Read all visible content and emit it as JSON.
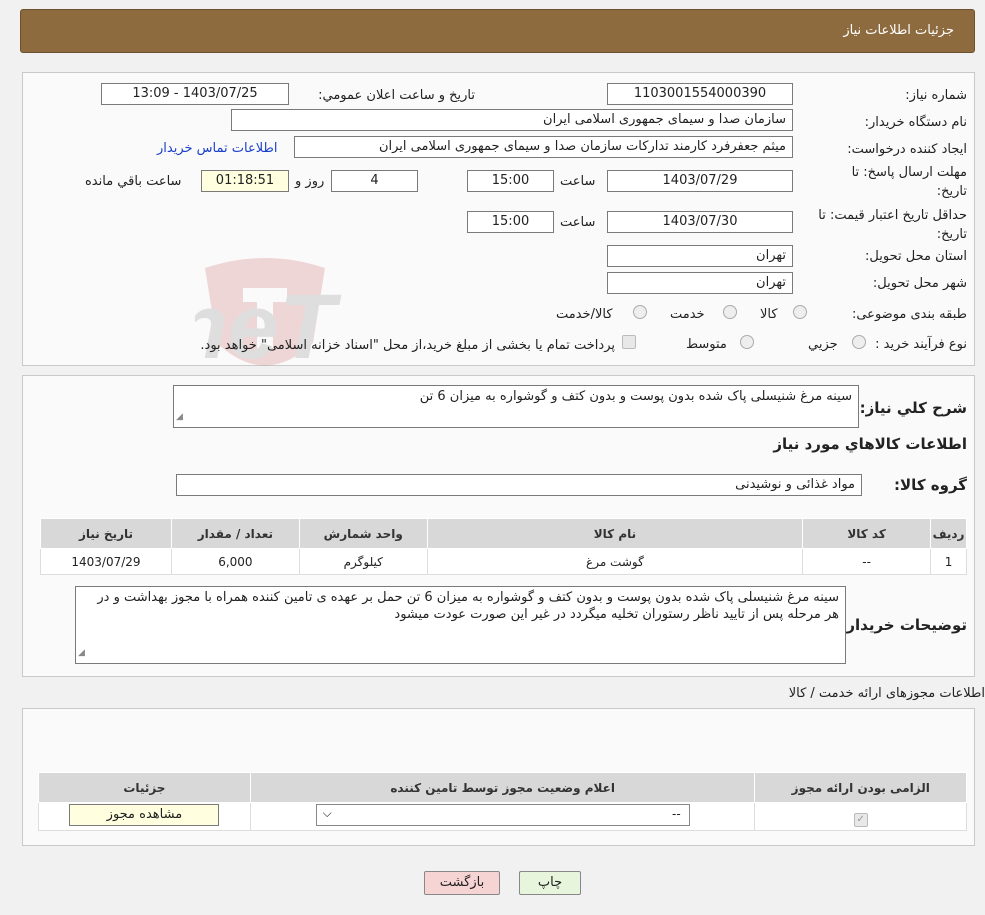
{
  "header": {
    "title": "جزئیات اطلاعات نیاز"
  },
  "fields": {
    "need_number_label": "شماره نیاز:",
    "need_number": "1103001554000390",
    "announce_label": "تاریخ و ساعت اعلان عمومي:",
    "announce_value": "1403/07/25 - 13:09",
    "buyer_org_label": "نام دستگاه خریدار:",
    "buyer_org": "سازمان صدا و سیمای جمهوری اسلامی ایران",
    "creator_label": "ایجاد کننده درخواست:",
    "creator": "میثم جعفرفرد کارمند تدارکات سازمان صدا و سیمای جمهوری اسلامی ایران",
    "contact_link": "اطلاعات تماس خریدار",
    "deadline_label": "مهلت ارسال پاسخ: تا تاریخ:",
    "deadline_date": "1403/07/29",
    "time_label": "ساعت",
    "deadline_time": "15:00",
    "days_value": "4",
    "days_label": "روز و",
    "remaining_time": "01:18:51",
    "remaining_label": "ساعت باقي مانده",
    "validity_label": "حداقل تاریخ اعتبار قیمت: تا تاریخ:",
    "validity_date": "1403/07/30",
    "validity_time": "15:00",
    "province_label": "استان محل تحویل:",
    "province": "تهران",
    "city_label": "شهر محل تحویل:",
    "city": "تهران",
    "category_label": "طبقه بندی موضوعی:",
    "category_options": [
      "کالا",
      "خدمت",
      "کالا/خدمت"
    ],
    "process_label": "نوع فرآیند خرید :",
    "process_options": [
      "جزیي",
      "متوسط"
    ],
    "process_note": "پرداخت تمام یا بخشی از مبلغ خرید،از محل \"اسناد خزانه اسلامی\" خواهد بود."
  },
  "description": {
    "label": "شرح کلي نیاز:",
    "value": "سینه مرغ شنیسلی پاک شده بدون پوست و بدون کتف و گوشواره به میزان 6 تن"
  },
  "goods": {
    "section_title": "اطلاعات کالاهاي مورد نیاز",
    "group_label": "گروه کالا:",
    "group_value": "مواد غذائی و نوشیدنی",
    "columns": [
      "ردیف",
      "کد کالا",
      "نام کالا",
      "واحد شمارش",
      "تعداد / مقدار",
      "تاریخ نیاز"
    ],
    "rows": [
      [
        "1",
        "--",
        "گوشت مرغ",
        "کیلوگرم",
        "6,000",
        "1403/07/29"
      ]
    ],
    "buyer_notes_label": "توضیحات خریدار:",
    "buyer_notes": "سینه مرغ شنیسلی پاک شده بدون پوست و بدون کتف و گوشواره به میزان 6 تن حمل بر عهده ی تامین کننده همراه با مجوز بهداشت و در هر مرحله پس از تایید ناظر رستوران تخلیه میگردد در غیر این صورت عودت میشود"
  },
  "permits": {
    "section_title": "اطلاعات مجوزهای ارائه خدمت / کالا",
    "columns": [
      "الزامی بودن ارائه مجوز",
      "اعلام وضعیت مجوز توسط تامین کننده",
      "جزئیات"
    ],
    "select_value": "--",
    "view_button": "مشاهده مجوز"
  },
  "buttons": {
    "print": "چاپ",
    "back": "بازگشت"
  },
  "colors": {
    "header": "#8d6b3f",
    "back_button": "#f7d4d4",
    "print_button": "#e6f5dc",
    "link": "#1a3fcc"
  }
}
